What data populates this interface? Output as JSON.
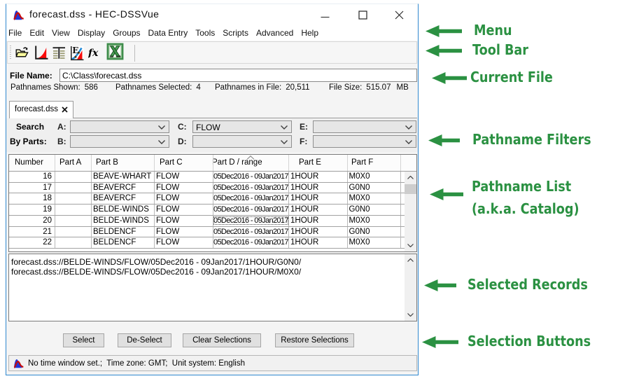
{
  "window": {
    "title": "forecast.dss - HEC-DSSVue",
    "menu": [
      "File",
      "Edit",
      "View",
      "Display",
      "Groups",
      "Data Entry",
      "Tools",
      "Scripts",
      "Advanced",
      "Help"
    ],
    "file_name": {
      "label": "File Name:",
      "value": "C:\\Class\\forecast.dss"
    },
    "info": [
      {
        "label": "Pathnames Shown:",
        "value": "586"
      },
      {
        "label": "Pathnames Selected:",
        "value": "4"
      },
      {
        "label": "Pathnames in File:",
        "value": "20,511"
      },
      {
        "label": "File Size:",
        "value": "515.07",
        "unit": "MB"
      }
    ],
    "tab": {
      "label": "forecast.dss"
    },
    "search": {
      "search_label": "Search",
      "by_parts_label": "By Parts:",
      "filters": [
        {
          "key": "A:",
          "value": ""
        },
        {
          "key": "B:",
          "value": ""
        },
        {
          "key": "C:",
          "value": "FLOW"
        },
        {
          "key": "D:",
          "value": ""
        },
        {
          "key": "E:",
          "value": ""
        },
        {
          "key": "F:",
          "value": ""
        }
      ]
    },
    "table": {
      "columns": [
        "Number",
        "Part A",
        "Part B",
        "Part C",
        "Part D / range",
        "Part E",
        "Part F"
      ],
      "rows": [
        [
          "16",
          "",
          "BEAVE-WHART",
          "FLOW",
          "05Dec2016 - 09Jan2017",
          "1HOUR",
          "M0X0"
        ],
        [
          "17",
          "",
          "BEAVERCF",
          "FLOW",
          "05Dec2016 - 09Jan2017",
          "1HOUR",
          "G0N0"
        ],
        [
          "18",
          "",
          "BEAVERCF",
          "FLOW",
          "05Dec2016 - 09Jan2017",
          "1HOUR",
          "M0X0"
        ],
        [
          "19",
          "",
          "BELDE-WINDS",
          "FLOW",
          "05Dec2016 - 09Jan2017",
          "1HOUR",
          "G0N0"
        ],
        [
          "20",
          "",
          "BELDE-WINDS",
          "FLOW",
          "05Dec2016 - 09Jan2017",
          "1HOUR",
          "M0X0"
        ],
        [
          "21",
          "",
          "BELDENCF",
          "FLOW",
          "05Dec2016 - 09Jan2017",
          "1HOUR",
          "G0N0"
        ],
        [
          "22",
          "",
          "BELDENCF",
          "FLOW",
          "05Dec2016 - 09Jan2017",
          "1HOUR",
          "M0X0"
        ]
      ]
    },
    "selected_records": [
      "forecast.dss://BELDE-WINDS/FLOW/05Dec2016 - 09Jan2017/1HOUR/G0N0/",
      "forecast.dss://BELDE-WINDS/FLOW/05Dec2016 - 09Jan2017/1HOUR/M0X0/"
    ],
    "buttons": [
      "Select",
      "De-Select",
      "Clear Selections",
      "Restore Selections"
    ],
    "status": "No time window set.;  Time zone: GMT;  Unit system: English"
  },
  "annotations": {
    "color": "#2b9142",
    "items": [
      {
        "label": "Menu"
      },
      {
        "label": "Tool Bar"
      },
      {
        "label": "Current File"
      },
      {
        "label": "Pathname Filters"
      },
      {
        "label": "Pathname List",
        "label2": "(a.k.a. Catalog)"
      },
      {
        "label": "Selected Records"
      },
      {
        "label": "Selection Buttons"
      }
    ]
  }
}
